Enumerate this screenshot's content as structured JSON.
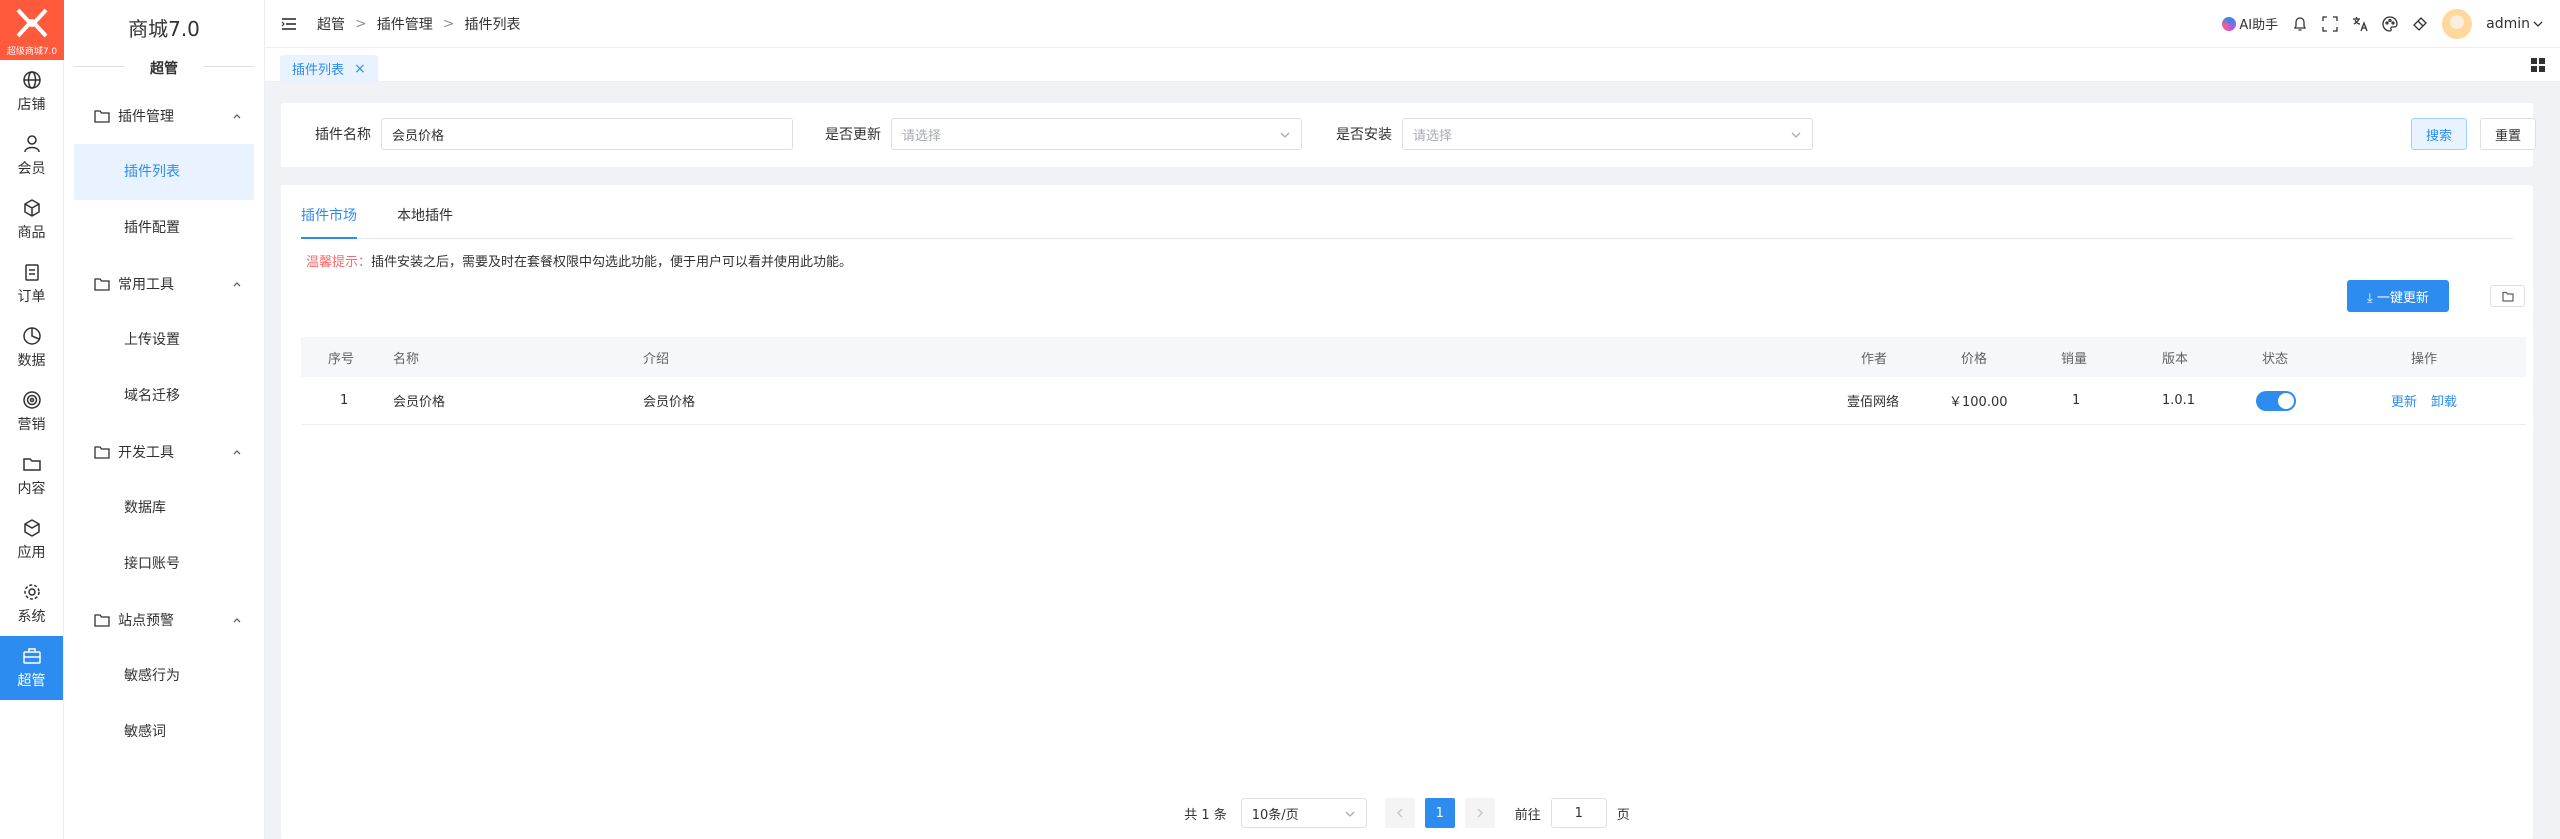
{
  "brand": {
    "logo_text": "超级商城7.0",
    "accent": "#2d8cf0",
    "logo_color": "#ff5a3c"
  },
  "rail": [
    {
      "label": "店铺",
      "icon": "globe-icon"
    },
    {
      "label": "会员",
      "icon": "user-icon"
    },
    {
      "label": "商品",
      "icon": "cube-icon"
    },
    {
      "label": "订单",
      "icon": "clipboard-icon"
    },
    {
      "label": "数据",
      "icon": "pie-chart-icon"
    },
    {
      "label": "营销",
      "icon": "target-icon"
    },
    {
      "label": "内容",
      "icon": "folder-icon"
    },
    {
      "label": "应用",
      "icon": "box-icon"
    },
    {
      "label": "系统",
      "icon": "gear-icon"
    },
    {
      "label": "超管",
      "icon": "briefcase-icon",
      "active": true
    }
  ],
  "sidebar": {
    "title": "商城7.0",
    "role": "超管",
    "groups": [
      {
        "label": "插件管理",
        "items": [
          "插件列表",
          "插件配置"
        ]
      },
      {
        "label": "常用工具",
        "items": [
          "上传设置",
          "域名迁移"
        ]
      },
      {
        "label": "开发工具",
        "items": [
          "数据库",
          "接口账号"
        ]
      },
      {
        "label": "站点预警",
        "items": [
          "敏感行为",
          "敏感词"
        ]
      }
    ],
    "active_item": "插件列表"
  },
  "header": {
    "breadcrumb": [
      "超管",
      "插件管理",
      "插件列表"
    ],
    "ai_label": "AI助手",
    "user": "admin"
  },
  "tabs": {
    "open": "插件列表",
    "close": "×"
  },
  "search": {
    "name_label": "插件名称",
    "name_value": "会员价格",
    "update_label": "是否更新",
    "update_placeholder": "请选择",
    "install_label": "是否安装",
    "install_placeholder": "请选择",
    "search_btn": "搜索",
    "reset_btn": "重置"
  },
  "main": {
    "tabs": [
      "插件市场",
      "本地插件"
    ],
    "tip_label": "温馨提示：",
    "tip_text": "插件安装之后，需要及时在套餐权限中勾选此功能，便于用户可以看并使用此功能。",
    "update_all": "⤓ 一键更新"
  },
  "table": {
    "columns": [
      "序号",
      "名称",
      "介绍",
      "作者",
      "价格",
      "销量",
      "版本",
      "状态",
      "操作"
    ],
    "rows": [
      {
        "index": "1",
        "name": "会员价格",
        "intro": "会员价格",
        "author": "壹佰网络",
        "price": "￥100.00",
        "sales": "1",
        "version": "1.0.1",
        "enabled": true,
        "actions": [
          "更新",
          "卸载"
        ]
      }
    ]
  },
  "pagination": {
    "total": "共 1 条",
    "page_size": "10条/页",
    "current": "1",
    "goto_label": "前往",
    "goto_value": "1",
    "page_unit": "页"
  }
}
